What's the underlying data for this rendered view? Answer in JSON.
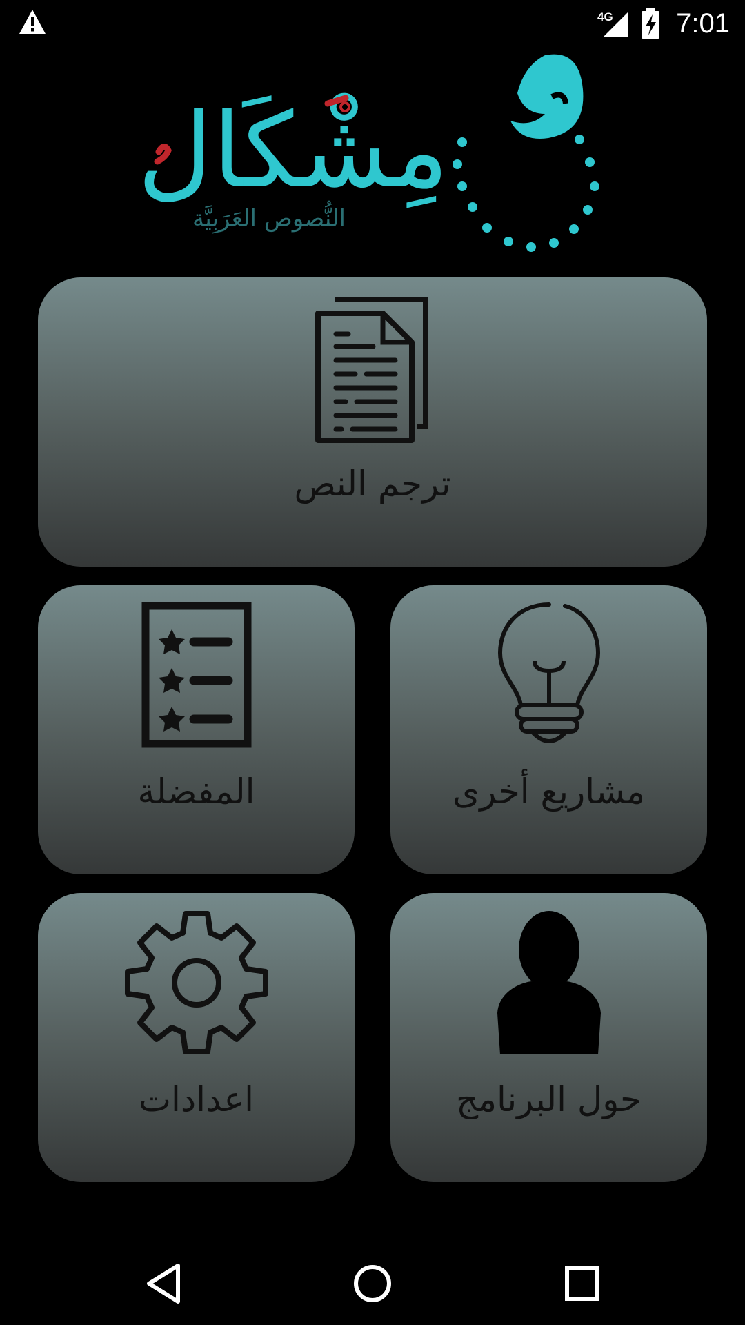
{
  "status_bar": {
    "time": "7:01",
    "network": "4G",
    "icons": [
      "warning-icon",
      "signal-icon",
      "battery-charging-icon"
    ]
  },
  "logo": {
    "title": "مِشْكَال",
    "subtitle": "النُّصوص العَرَبِيَّة",
    "accent_color": "#2fc7cf",
    "mark_color": "#c0262c"
  },
  "tiles": {
    "translate": {
      "label": "ترجم النص",
      "icon": "document-icon"
    },
    "favorites": {
      "label": "المفضلة",
      "icon": "star-list-icon"
    },
    "other_projects": {
      "label": "مشاريع أخرى",
      "icon": "lightbulb-icon"
    },
    "settings": {
      "label": "اعدادات",
      "icon": "gear-icon"
    },
    "about": {
      "label": "حول البرنامج",
      "icon": "person-icon"
    }
  },
  "nav_bar": {
    "icons": [
      "back-icon",
      "home-icon",
      "recents-icon"
    ]
  }
}
